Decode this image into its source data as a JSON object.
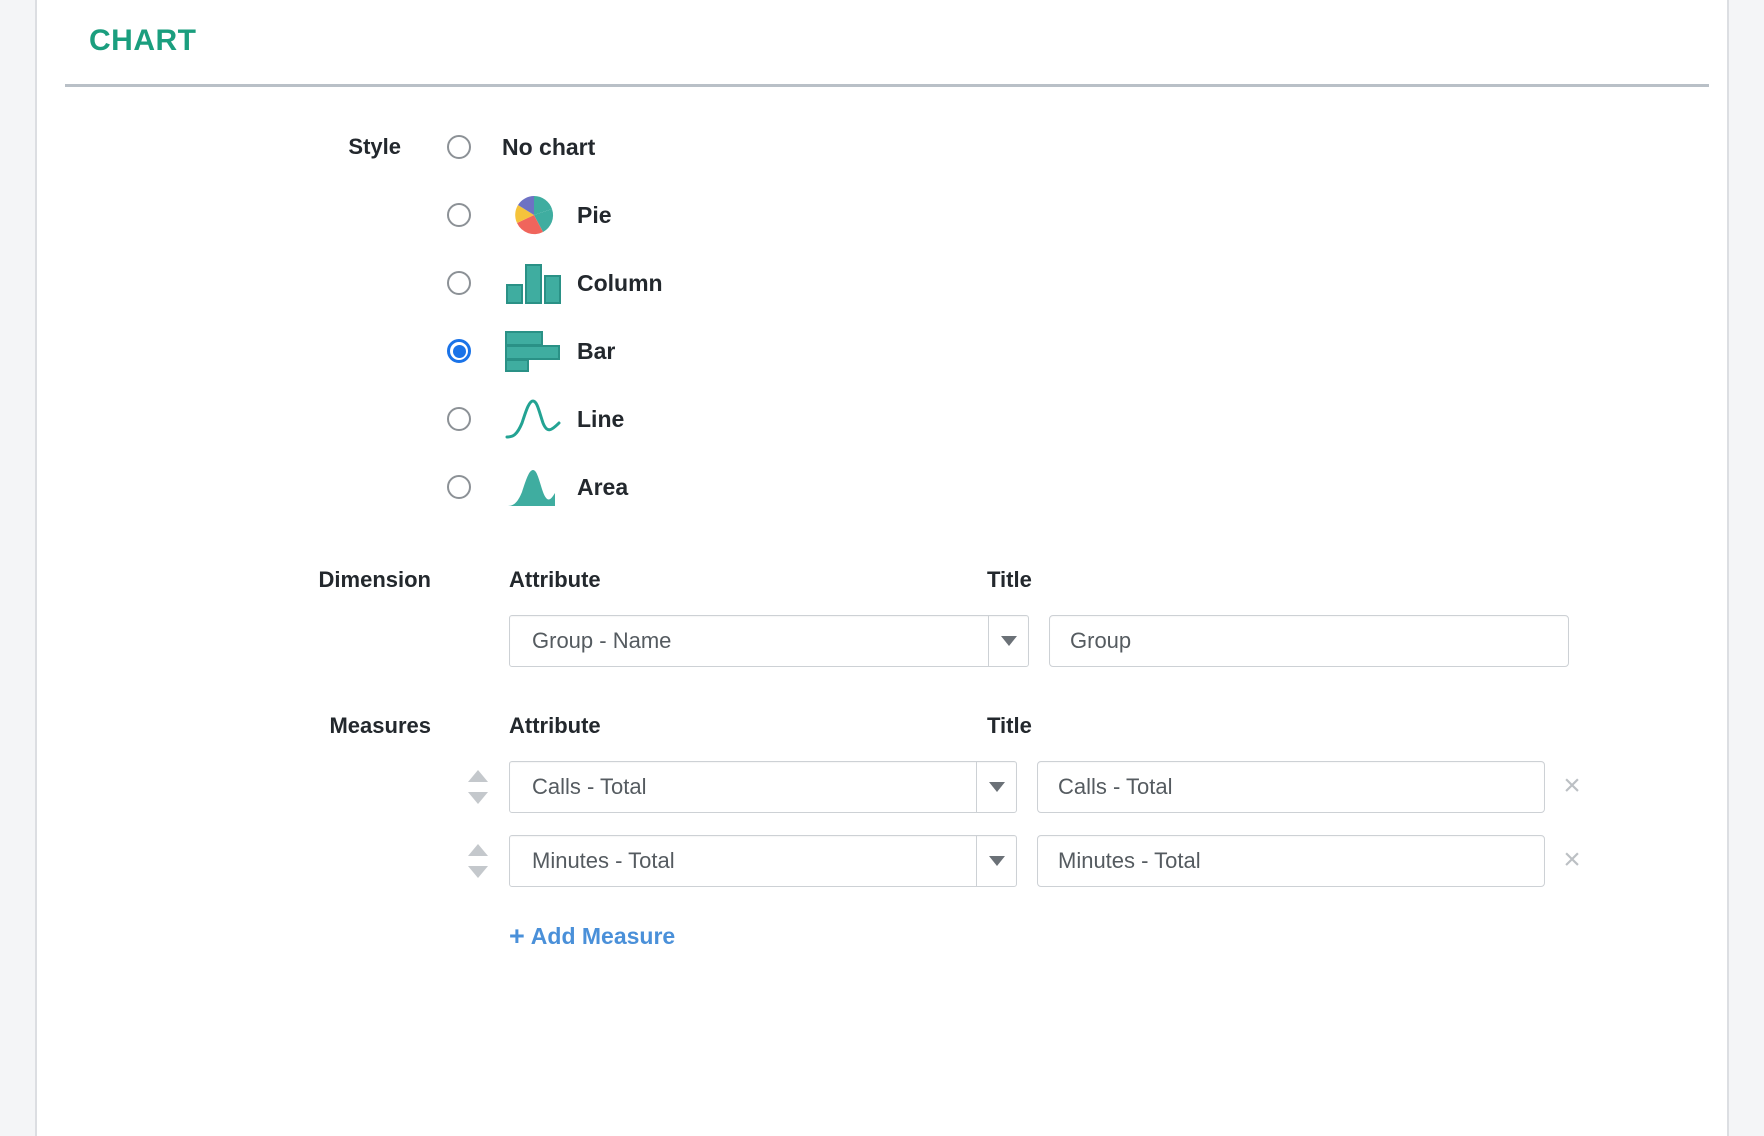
{
  "panel": {
    "title": "CHART"
  },
  "style": {
    "label": "Style",
    "options": [
      {
        "label": "No chart",
        "icon": "none-icon",
        "selected": false
      },
      {
        "label": "Pie",
        "icon": "pie-chart-icon",
        "selected": false
      },
      {
        "label": "Column",
        "icon": "column-chart-icon",
        "selected": false
      },
      {
        "label": "Bar",
        "icon": "bar-chart-icon",
        "selected": true
      },
      {
        "label": "Line",
        "icon": "line-chart-icon",
        "selected": false
      },
      {
        "label": "Area",
        "icon": "area-chart-icon",
        "selected": false
      }
    ]
  },
  "dimension": {
    "label": "Dimension",
    "attribute_header": "Attribute",
    "title_header": "Title",
    "attribute_value": "Group - Name",
    "title_value": "Group"
  },
  "measures": {
    "label": "Measures",
    "attribute_header": "Attribute",
    "title_header": "Title",
    "rows": [
      {
        "attribute_value": "Calls - Total",
        "title_value": "Calls - Total",
        "remove_label": "×",
        "handle": "sort-handle-icon"
      },
      {
        "attribute_value": "Minutes - Total",
        "title_value": "Minutes - Total",
        "remove_label": "×",
        "handle": "sort-handle-icon"
      }
    ],
    "add_label": "Add Measure",
    "add_plus": "+"
  },
  "colors": {
    "accent_teal": "#1a9e7e",
    "icon_teal": "#3fada0",
    "radio_blue": "#1a73e8",
    "link_blue": "#4a90d9",
    "pie_slice_teal": "#3fada0",
    "pie_slice_purple": "#6e72c4",
    "pie_slice_yellow": "#f5c33b",
    "pie_slice_red": "#f0655c"
  },
  "chart_data": {
    "type": "bar",
    "title": "Chart configuration preview icons",
    "xlabel": "",
    "ylabel": "",
    "icons": [
      {
        "name": "pie-chart-icon",
        "type": "pie",
        "slices": [
          40,
          15,
          20,
          25
        ],
        "colors": [
          "#3fada0",
          "#6e72c4",
          "#f5c33b",
          "#f0655c"
        ]
      },
      {
        "name": "column-chart-icon",
        "type": "bar",
        "categories": [
          "1",
          "2",
          "3"
        ],
        "values": [
          40,
          100,
          72
        ]
      },
      {
        "name": "bar-chart-icon",
        "type": "bar",
        "categories": [
          "1",
          "2",
          "3"
        ],
        "values": [
          68,
          100,
          42
        ]
      },
      {
        "name": "line-chart-icon",
        "type": "line",
        "x": [
          0,
          1,
          2,
          3,
          4,
          5
        ],
        "values": [
          8,
          14,
          96,
          18,
          40,
          30
        ]
      },
      {
        "name": "area-chart-icon",
        "type": "area",
        "x": [
          0,
          1,
          2,
          3,
          4,
          5
        ],
        "values": [
          8,
          14,
          96,
          18,
          48,
          30
        ]
      }
    ]
  }
}
